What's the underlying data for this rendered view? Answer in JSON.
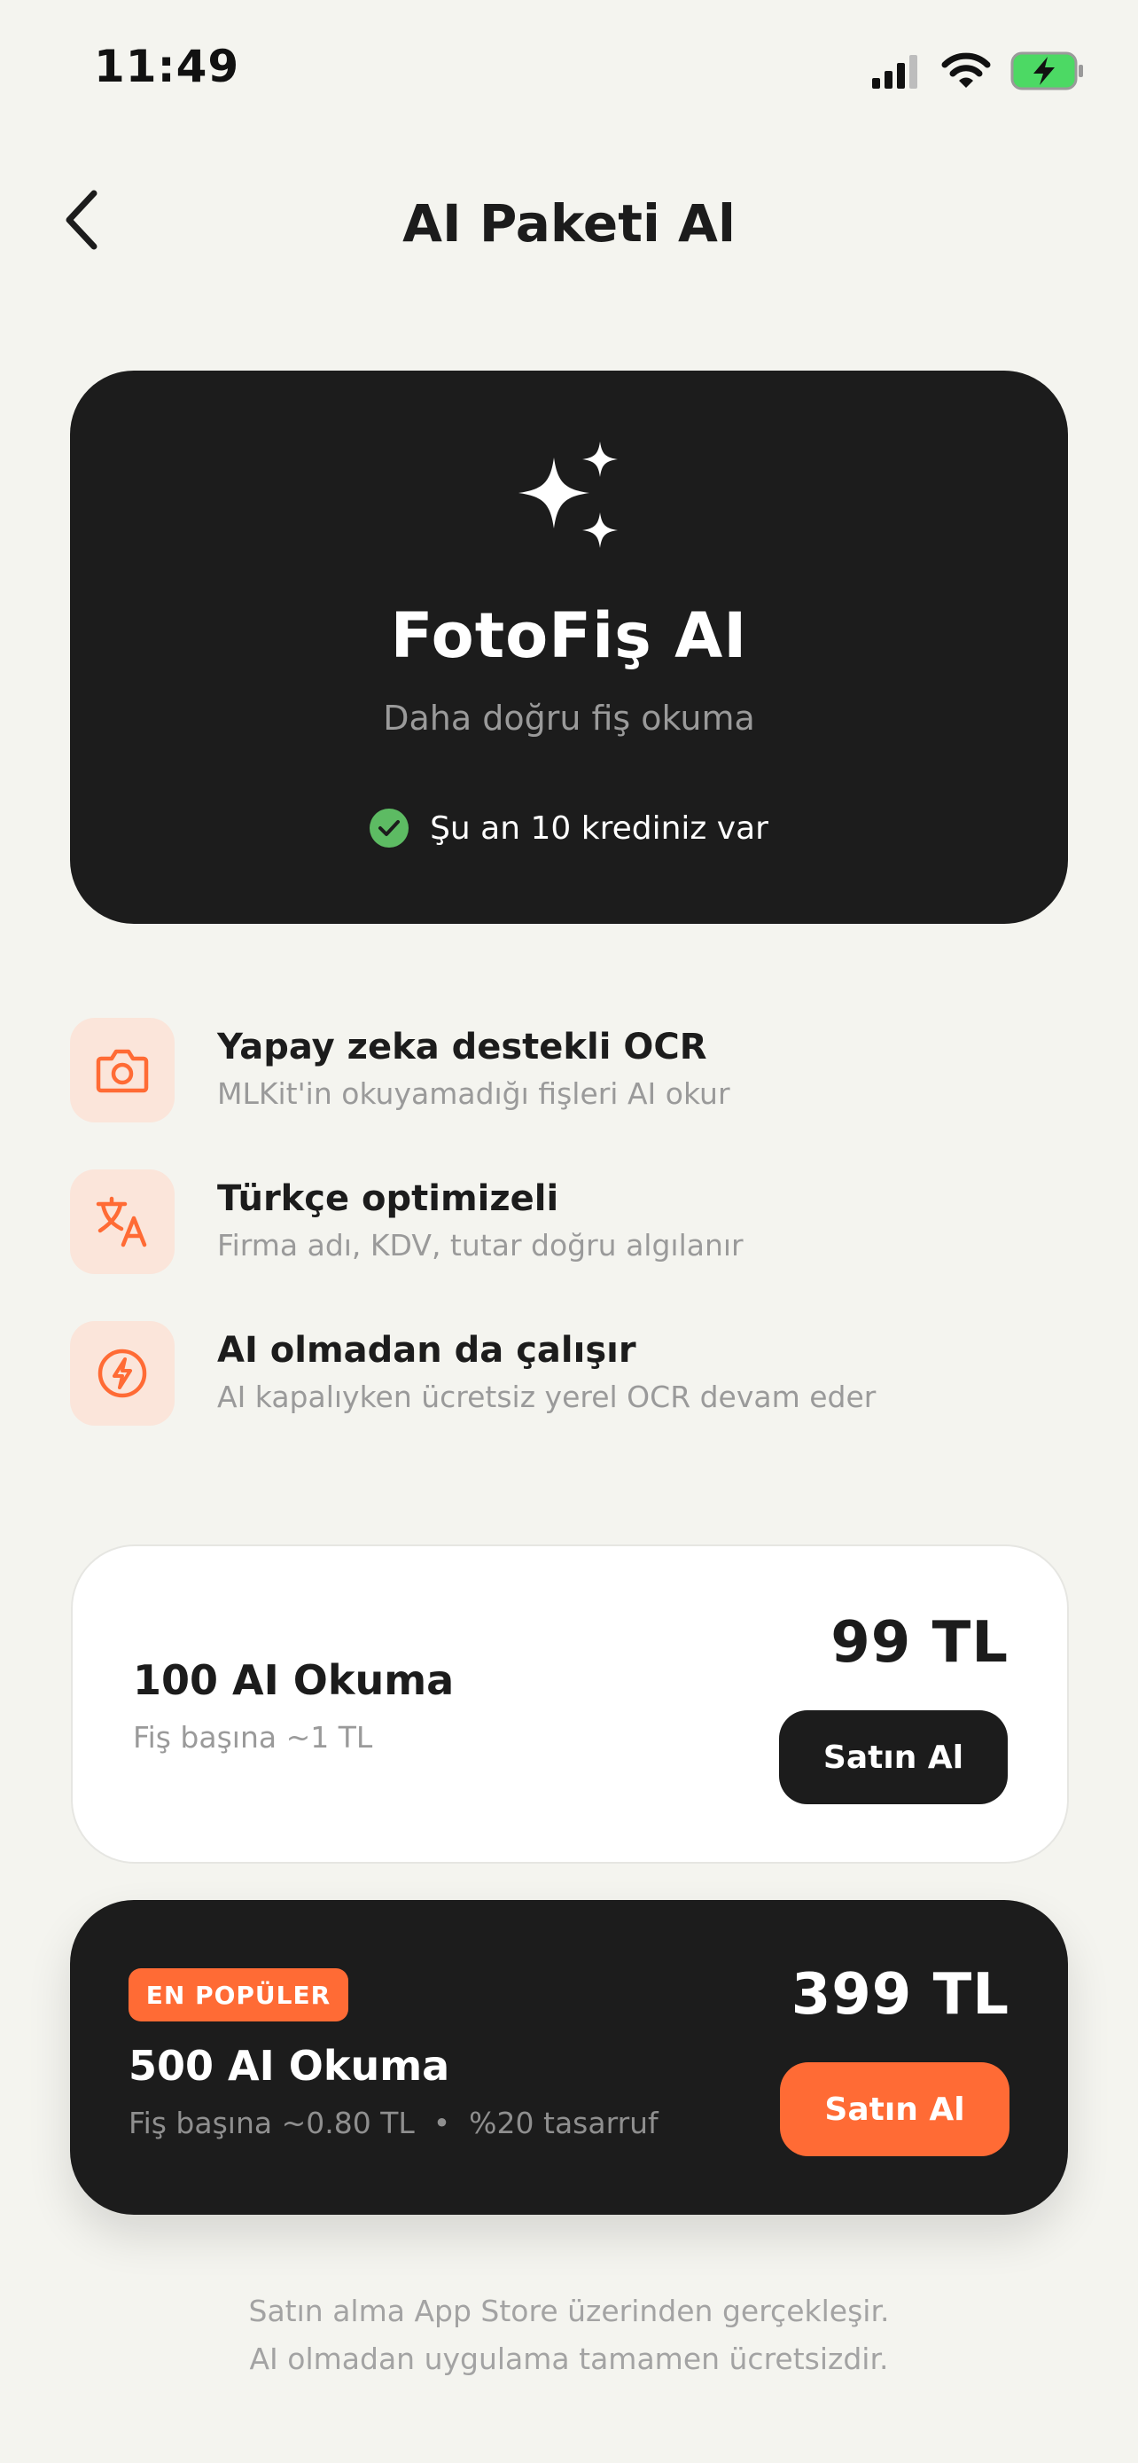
{
  "status_bar": {
    "time": "11:49"
  },
  "nav": {
    "title": "AI Paketi Al"
  },
  "hero": {
    "title": "FotoFiş AI",
    "subtitle": "Daha doğru fiş okuma",
    "credit_text": "Şu an 10 krediniz var"
  },
  "features": [
    {
      "icon": "camera-icon",
      "title": "Yapay zeka destekli OCR",
      "desc": "MLKit'in okuyamadığı fişleri AI okur"
    },
    {
      "icon": "translate-icon",
      "title": "Türkçe optimizeli",
      "desc": "Firma adı, KDV, tutar doğru algılanır"
    },
    {
      "icon": "bolt-icon",
      "title": "AI olmadan da çalışır",
      "desc": "AI kapalıyken ücretsiz yerel OCR devam eder"
    }
  ],
  "packages": [
    {
      "name": "100 AI Okuma",
      "desc": "Fiş başına ~1 TL",
      "price": "99 TL",
      "buy_label": "Satın Al"
    },
    {
      "badge": "EN POPÜLER",
      "name": "500 AI Okuma",
      "desc": "Fiş başına ~0.80 TL  •  %20 tasarruf",
      "price": "399 TL",
      "buy_label": "Satın Al"
    }
  ],
  "footer": {
    "line1": "Satın alma App Store üzerinden gerçekleşir.",
    "line2": "AI olmadan uygulama tamamen ücretsizdir."
  },
  "colors": {
    "accent": "#ff6b35",
    "dark": "#1c1c1c",
    "background": "#f4f4ef",
    "icon_bg": "#fbe5da",
    "check_green": "#5dbb63"
  }
}
